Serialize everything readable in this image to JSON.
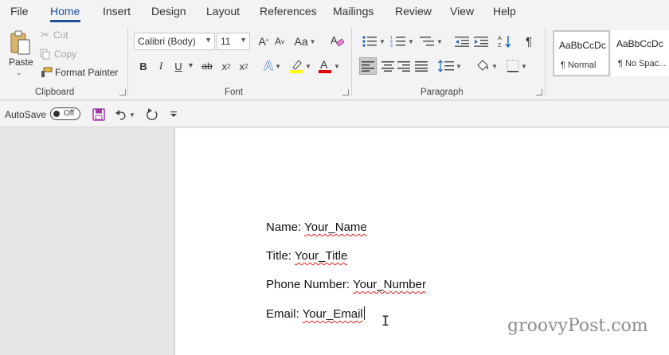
{
  "tabs": [
    "File",
    "Home",
    "Insert",
    "Design",
    "Layout",
    "References",
    "Mailings",
    "Review",
    "View",
    "Help"
  ],
  "active_tab": "Home",
  "clipboard": {
    "paste_label": "Paste",
    "cut_label": "Cut",
    "copy_label": "Copy",
    "format_painter_label": "Format Painter",
    "group_label": "Clipboard"
  },
  "font": {
    "font_name": "Calibri (Body)",
    "font_size": "11",
    "grow_label": "A",
    "shrink_label": "A",
    "case_label": "Aa",
    "bold": "B",
    "italic": "I",
    "underline": "U",
    "strike": "ab",
    "subscript": "x",
    "superscript": "x",
    "text_effects": "A",
    "font_color": "A",
    "group_label": "Font",
    "highlight_color": "#ffff00",
    "font_color_value": "#e00000"
  },
  "paragraph": {
    "group_label": "Paragraph",
    "show_marks": "¶"
  },
  "styles": {
    "items": [
      {
        "sample": "AaBbCcDc",
        "name": "¶ Normal"
      },
      {
        "sample": "AaBbCcDc",
        "name": "¶ No Spac..."
      }
    ]
  },
  "qat": {
    "autosave_label": "AutoSave",
    "autosave_state": "Off"
  },
  "document": {
    "lines": [
      {
        "label": "Name:",
        "value": "Your_Name"
      },
      {
        "label": "Title:",
        "value": "Your_Title"
      },
      {
        "label": "Phone Number:",
        "value": "Your_Number"
      },
      {
        "label": "Email:",
        "value": "Your_Email"
      }
    ]
  },
  "watermark": "groovyPost.com"
}
